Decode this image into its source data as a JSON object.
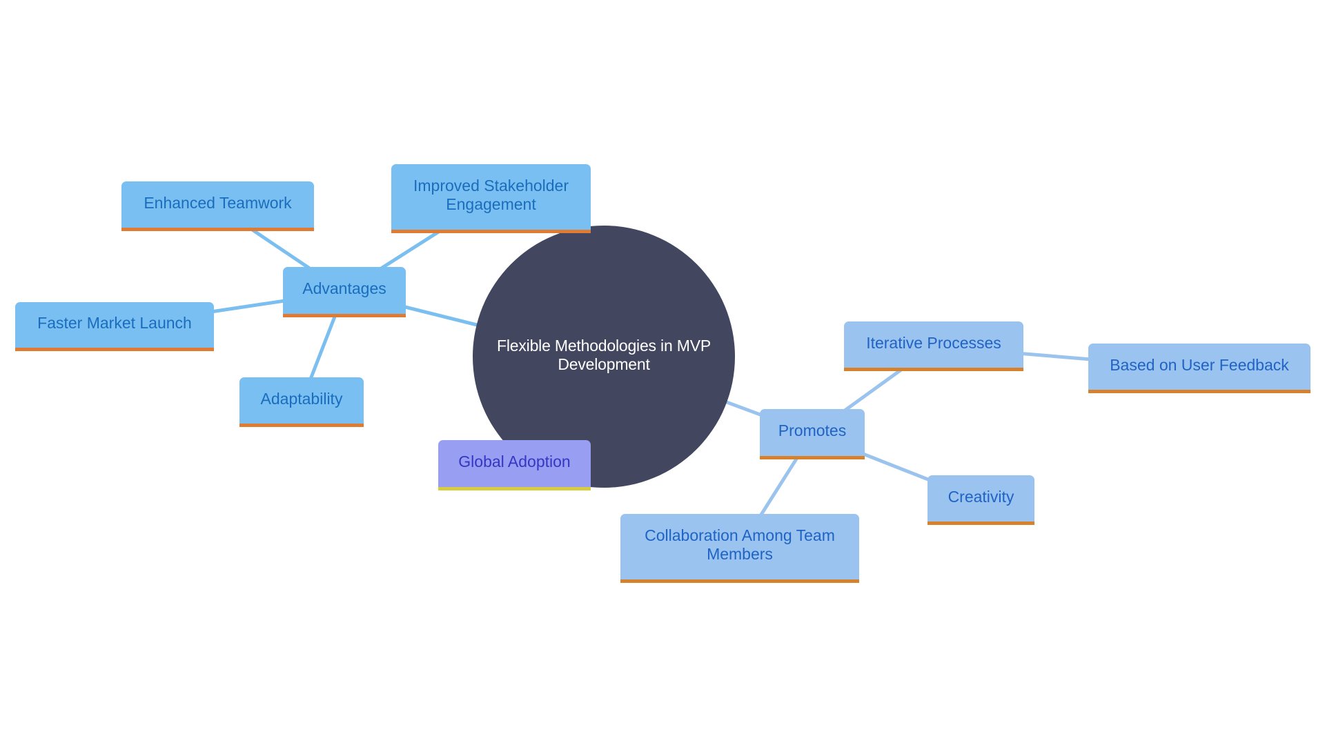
{
  "diagram": {
    "type": "mindmap",
    "root": {
      "label": "Flexible Methodologies in MVP Development"
    },
    "branches": {
      "advantages": {
        "label": "Advantages",
        "children": {
          "enhanced_teamwork": "Enhanced Teamwork",
          "improved_stakeholder_engagement": "Improved Stakeholder Engagement",
          "faster_market_launch": "Faster Market Launch",
          "adaptability": "Adaptability"
        }
      },
      "global_adoption": {
        "label": "Global Adoption"
      },
      "promotes": {
        "label": "Promotes",
        "children": {
          "iterative_processes": {
            "label": "Iterative Processes",
            "children": {
              "based_on_user_feedback": "Based on User Feedback"
            }
          },
          "creativity": "Creativity",
          "collaboration": "Collaboration Among Team Members"
        }
      }
    },
    "colors": {
      "root_fill": "#42465e",
      "root_text": "#ffffff",
      "advantages_fill": "#7abff2",
      "advantages_text": "#1a6dbd",
      "advantages_accent": "#e07b34",
      "promotes_fill": "#9ac3ef",
      "promotes_text": "#1f63c4",
      "promotes_accent": "#d6822c",
      "global_fill": "#989ef2",
      "global_text": "#3337c4",
      "global_accent": "#d6cc3c"
    }
  }
}
